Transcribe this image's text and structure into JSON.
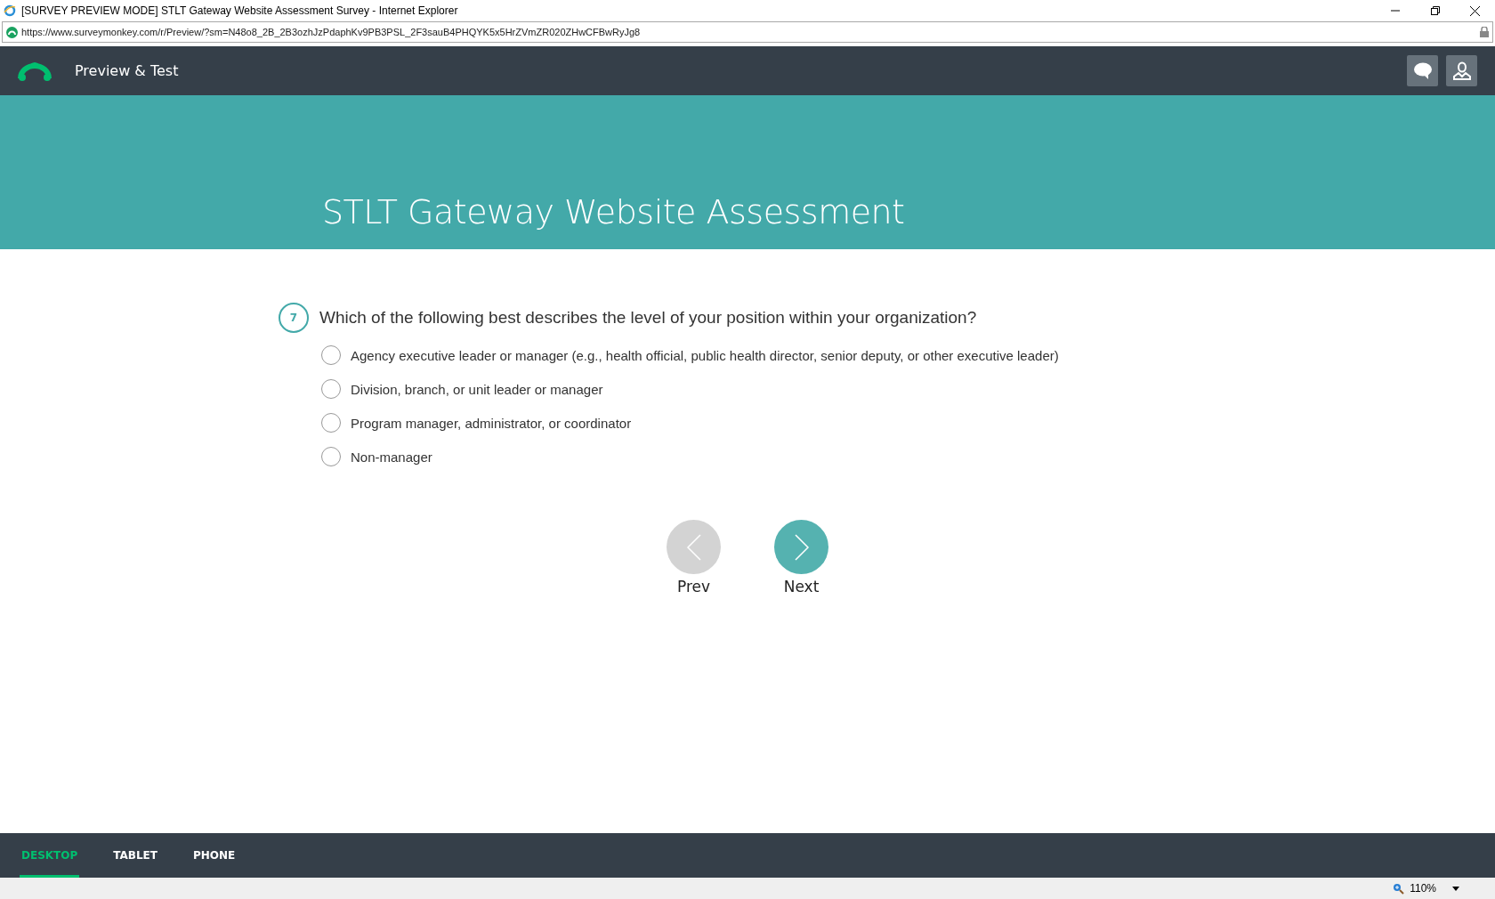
{
  "window": {
    "title": "[SURVEY PREVIEW MODE] STLT Gateway Website Assessment Survey - Internet Explorer",
    "url": "https://www.surveymonkey.com/r/Preview/?sm=N48o8_2B_2B3ozhJzPdaphKv9PB3PSL_2F3sauB4PHQYK5x5HrZVmZR020ZHwCFBwRyJg8"
  },
  "header": {
    "title": "Preview & Test"
  },
  "banner": {
    "title": "STLT Gateway Website Assessment"
  },
  "question": {
    "number": "7",
    "text": "Which of the following best describes the level of your position within your organization?",
    "options": [
      {
        "label": "Agency executive leader or manager (e.g., health official, public health director, senior deputy, or other executive leader)",
        "selected": false
      },
      {
        "label": "Division, branch, or unit leader or manager",
        "selected": false
      },
      {
        "label": "Program manager, administrator, or coordinator",
        "selected": false
      },
      {
        "label": "Non-manager",
        "selected": false
      }
    ]
  },
  "navigation": [
    {
      "kind": "prev",
      "label": "Prev",
      "disabled": true
    },
    {
      "kind": "next",
      "label": "Next",
      "disabled": false
    }
  ],
  "device_tabs": [
    {
      "label": "DESKTOP",
      "selected": true
    },
    {
      "label": "TABLET",
      "selected": false
    },
    {
      "label": "PHONE",
      "selected": false
    }
  ],
  "status_bar": {
    "zoom": "110%"
  }
}
